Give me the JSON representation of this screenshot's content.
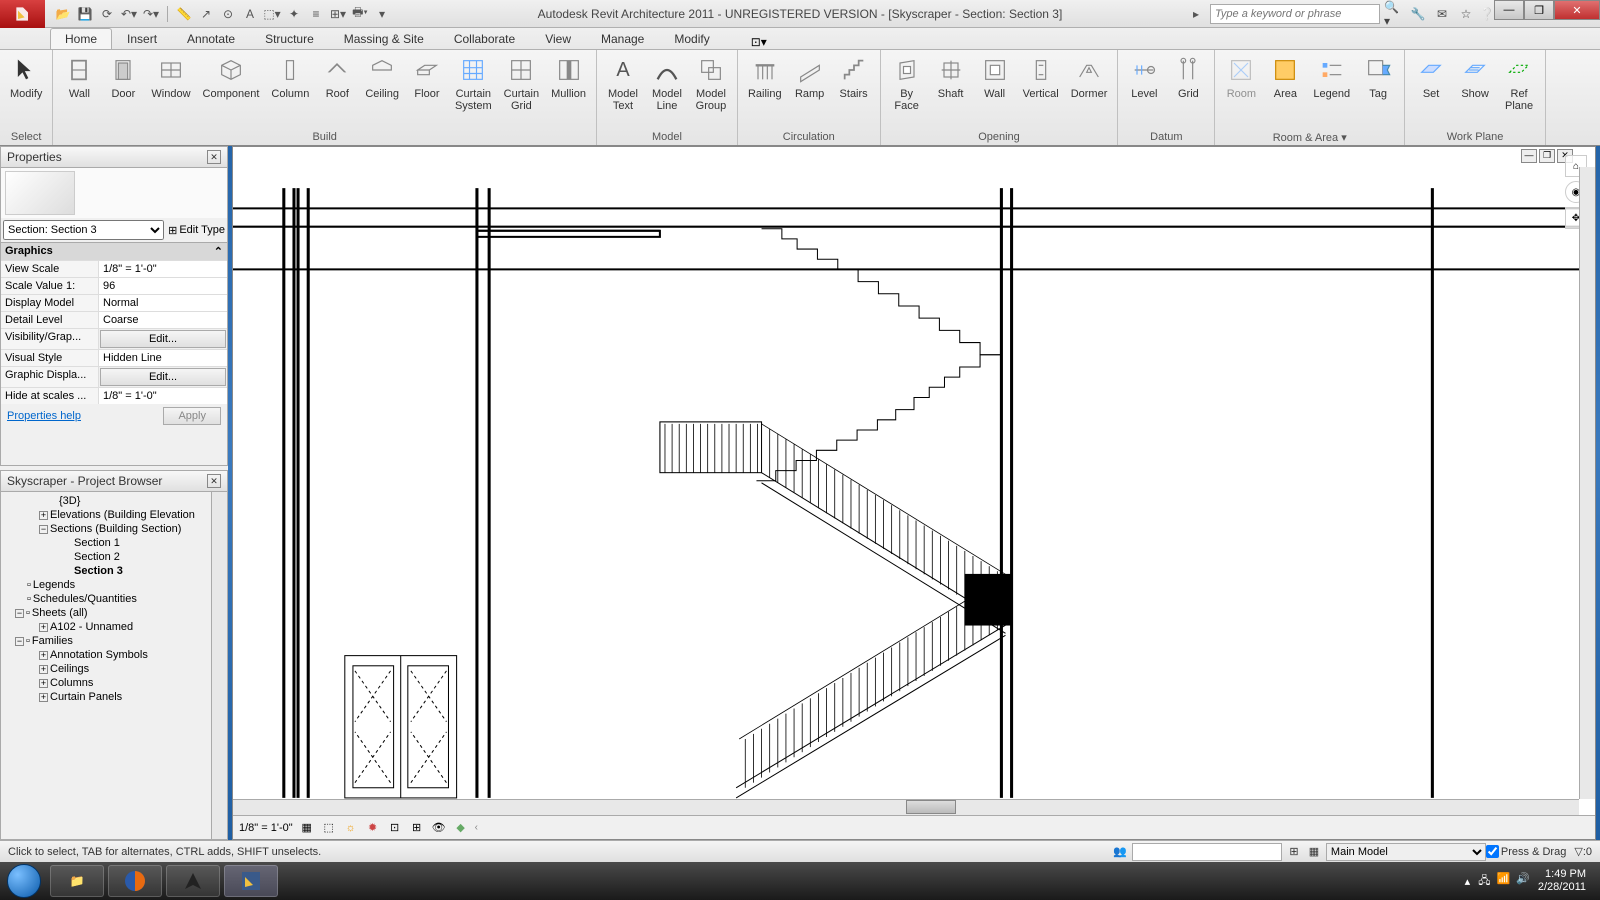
{
  "title": "Autodesk Revit Architecture 2011 - UNREGISTERED VERSION - [Skyscraper - Section: Section 3]",
  "search_placeholder": "Type a keyword or phrase",
  "tabs": [
    "Home",
    "Insert",
    "Annotate",
    "Structure",
    "Massing & Site",
    "Collaborate",
    "View",
    "Manage",
    "Modify"
  ],
  "active_tab": "Home",
  "ribbon": {
    "select": {
      "label": "Select",
      "modify": "Modify"
    },
    "build": {
      "label": "Build",
      "wall": "Wall",
      "door": "Door",
      "window": "Window",
      "component": "Component",
      "column": "Column",
      "roof": "Roof",
      "ceiling": "Ceiling",
      "floor": "Floor",
      "curtain_system": "Curtain\nSystem",
      "curtain_grid": "Curtain\nGrid",
      "mullion": "Mullion"
    },
    "model": {
      "label": "Model",
      "model_text": "Model\nText",
      "model_line": "Model\nLine",
      "model_group": "Model\nGroup"
    },
    "circulation": {
      "label": "Circulation",
      "railing": "Railing",
      "ramp": "Ramp",
      "stairs": "Stairs"
    },
    "opening": {
      "label": "Opening",
      "by_face": "By\nFace",
      "shaft": "Shaft",
      "wall": "Wall",
      "vertical": "Vertical",
      "dormer": "Dormer"
    },
    "datum": {
      "label": "Datum",
      "level": "Level",
      "grid": "Grid"
    },
    "room_area": {
      "label": "Room & Area ▾",
      "room": "Room",
      "area": "Area",
      "legend": "Legend",
      "tag": "Tag"
    },
    "work_plane": {
      "label": "Work Plane",
      "set": "Set",
      "show": "Show",
      "ref_plane": "Ref\nPlane"
    }
  },
  "properties": {
    "title": "Properties",
    "selector": "Section: Section 3",
    "edit_type": "Edit Type",
    "category": "Graphics",
    "rows": [
      {
        "name": "View Scale",
        "val": "1/8\" = 1'-0\""
      },
      {
        "name": "Scale Value   1:",
        "val": "96"
      },
      {
        "name": "Display Model",
        "val": "Normal"
      },
      {
        "name": "Detail Level",
        "val": "Coarse"
      },
      {
        "name": "Visibility/Grap...",
        "val": "Edit...",
        "btn": true
      },
      {
        "name": "Visual Style",
        "val": "Hidden Line"
      },
      {
        "name": "Graphic Displa...",
        "val": "Edit...",
        "btn": true
      },
      {
        "name": "Hide at scales ...",
        "val": "1/8\" = 1'-0\""
      }
    ],
    "help": "Properties help",
    "apply": "Apply"
  },
  "browser": {
    "title": "Skyscraper - Project Browser",
    "items": [
      {
        "indent": 50,
        "label": "{3D}"
      },
      {
        "indent": 30,
        "exp": "+",
        "label": "Elevations (Building Elevation"
      },
      {
        "indent": 30,
        "exp": "−",
        "label": "Sections (Building Section)"
      },
      {
        "indent": 65,
        "label": "Section 1"
      },
      {
        "indent": 65,
        "label": "Section 2"
      },
      {
        "indent": 65,
        "label": "Section 3",
        "bold": true
      },
      {
        "indent": 18,
        "icon": true,
        "label": "Legends"
      },
      {
        "indent": 18,
        "icon": true,
        "label": "Schedules/Quantities"
      },
      {
        "indent": 6,
        "exp": "−",
        "icon": true,
        "label": "Sheets (all)"
      },
      {
        "indent": 30,
        "exp": "+",
        "label": "A102 - Unnamed"
      },
      {
        "indent": 6,
        "exp": "−",
        "icon": true,
        "label": "Families"
      },
      {
        "indent": 30,
        "exp": "+",
        "label": "Annotation Symbols"
      },
      {
        "indent": 30,
        "exp": "+",
        "label": "Ceilings"
      },
      {
        "indent": 30,
        "exp": "+",
        "label": "Columns"
      },
      {
        "indent": 30,
        "exp": "+",
        "label": "Curtain Panels"
      }
    ]
  },
  "view_scale": "1/8\" = 1'-0\"",
  "status": {
    "hint": "Click to select, TAB for alternates, CTRL adds, SHIFT unselects.",
    "workset": "Main Model",
    "press_drag": "Press & Drag",
    "filter_count": ":0"
  },
  "clock": {
    "time": "1:49 PM",
    "date": "2/28/2011"
  }
}
